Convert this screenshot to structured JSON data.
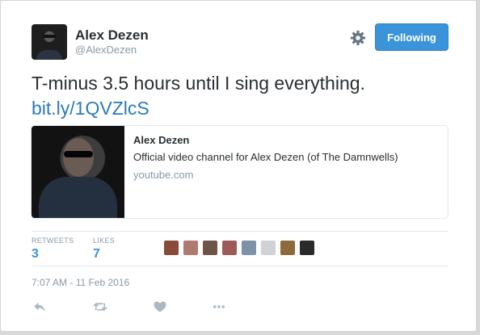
{
  "user": {
    "name": "Alex Dezen",
    "handle": "@AlexDezen"
  },
  "follow_button": {
    "label": "Following",
    "color": "#3b94d9"
  },
  "tweet": {
    "text": "T-minus 3.5 hours until I sing everything.",
    "link": "bit.ly/1QVZlcS"
  },
  "preview_card": {
    "title": "Alex Dezen",
    "description": "Official video channel for Alex Dezen (of The Damnwells)",
    "domain": "youtube.com"
  },
  "stats": {
    "retweets_label": "RETWEETS",
    "retweets_count": "3",
    "likes_label": "LIKES",
    "likes_count": "7"
  },
  "likers": [
    {
      "color": "#8a4a3a"
    },
    {
      "color": "#b07a70"
    },
    {
      "color": "#6e5548"
    },
    {
      "color": "#9c5a58"
    },
    {
      "color": "#7f93a6"
    },
    {
      "color": "#cfd3d6"
    },
    {
      "color": "#8c6a3e"
    },
    {
      "color": "#2a2a2a"
    }
  ],
  "timestamp": "7:07 AM - 11 Feb 2016",
  "icons": {
    "settings": "gear-icon",
    "reply": "reply-icon",
    "retweet": "retweet-icon",
    "like": "heart-icon",
    "more": "more-icon"
  },
  "colors": {
    "link": "#2b7bb9",
    "muted": "#8899a6",
    "text": "#292f33"
  }
}
